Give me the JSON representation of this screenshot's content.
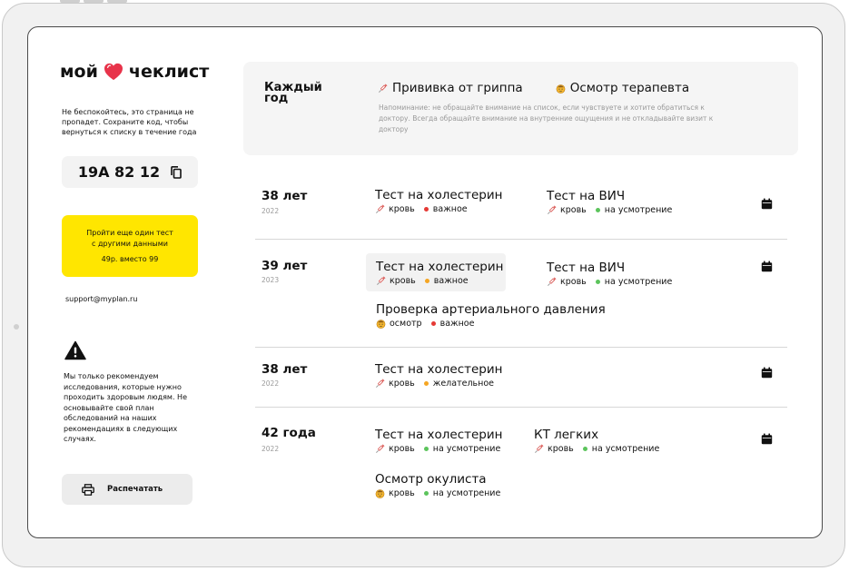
{
  "brand": {
    "before": "мой",
    "after": "чеклист",
    "heart_color": "#e8334a"
  },
  "sidebar": {
    "note": "Не беспокойтесь, это страница не пропадет. Сохраните код, чтобы вернуться к списку в течение года",
    "code": "19A 82 12",
    "promo": {
      "line1": "Пройти еще один тест",
      "line2": "с другими данными",
      "price": "49р. вместо 99",
      "color": "#ffe600"
    },
    "support": "support@myplan.ru",
    "disclaimer": "Мы только рекомендуем исследования, которые нужно проходить здоровым людям. Не основывайте свой план обследований на наших рекомендациях в следующих случаях.",
    "print_label": "Распечатать"
  },
  "yearly": {
    "label": "Каждый год",
    "items": [
      "Прививка от гриппа",
      "Осмотр терапевта"
    ],
    "reminder": "Напоминание: не обращайте внимание на список, если чувствуете и хотите обратиться к доктору. Всегда обращайте внимание на внутренние ощущения и не откладывайте визит к доктору"
  },
  "colors": {
    "important": "#e53935",
    "optional": "#f5a623",
    "consider": "#5cc45c"
  },
  "rows": [
    {
      "age": "38 лет",
      "year": "2022",
      "tests": [
        {
          "title": "Тест на холестерин",
          "type": "кровь",
          "priority": "важное"
        },
        {
          "title": "Тест на ВИЧ",
          "type": "кровь",
          "priority": "на усмотрение"
        }
      ]
    },
    {
      "age": "39 лет",
      "year": "2023",
      "tests": [
        {
          "title": "Тест на холестерин",
          "type": "кровь",
          "priority": "важное"
        },
        {
          "title": "Тест на ВИЧ",
          "type": "кровь",
          "priority": "на усмотрение"
        },
        {
          "title": "Проверка артериального давления",
          "type": "осмотр",
          "priority": "важное"
        }
      ]
    },
    {
      "age": "38 лет",
      "year": "2022",
      "tests": [
        {
          "title": "Тест на холестерин",
          "type": "кровь",
          "priority": "желательное"
        }
      ]
    },
    {
      "age": "42 года",
      "year": "2022",
      "tests": [
        {
          "title": "Тест на холестерин",
          "type": "кровь",
          "priority": "на усмотрение"
        },
        {
          "title": "КТ легких",
          "type": "кровь",
          "priority": "на усмотрение"
        },
        {
          "title": "Осмотр окулиста",
          "type": "кровь",
          "priority": "на усмотрение"
        }
      ]
    }
  ]
}
